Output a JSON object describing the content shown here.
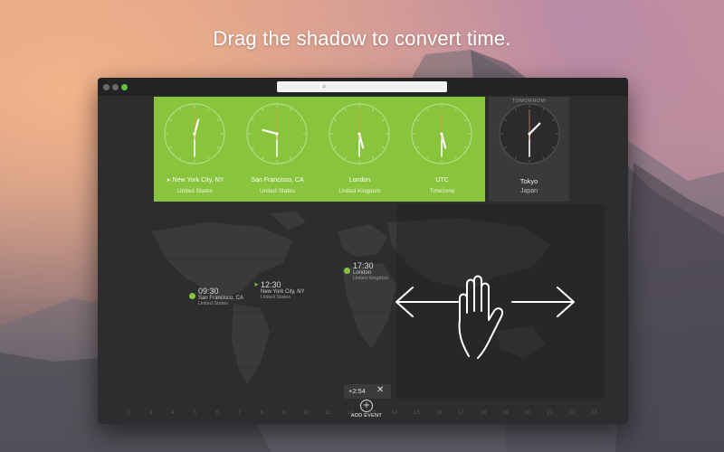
{
  "headline": "Drag the shadow to convert time.",
  "window": {
    "search_icon": "search-icon"
  },
  "clocks": [
    {
      "city": "New York City, NY",
      "country": "United States",
      "hour": 12,
      "minute": 30,
      "current_location": true
    },
    {
      "city": "San Francisco, CA",
      "country": "United States",
      "hour": 9,
      "minute": 30,
      "current_location": false
    },
    {
      "city": "London",
      "country": "United Kingdom",
      "hour": 17,
      "minute": 30,
      "current_location": false
    },
    {
      "city": "UTC",
      "country": "Timezone",
      "hour": 17,
      "minute": 30,
      "current_location": false
    }
  ],
  "tomorrow": {
    "label": "TOMORROW",
    "city": "Tokyo",
    "country": "Japan",
    "hour": 1,
    "minute": 30
  },
  "map_labels": {
    "sf": {
      "time": "09:30",
      "place": "San Francisco, CA",
      "country": "United States"
    },
    "nyc": {
      "time": "12:30",
      "place": "New York City, NY",
      "country": "United States"
    },
    "london": {
      "time": "17:30",
      "place": "London",
      "country": "United Kingdom"
    }
  },
  "offset": {
    "value": "+2:54",
    "close": "✕"
  },
  "add_event": {
    "label": "ADD EVENT",
    "icon": "+"
  },
  "timeline_hours": [
    "2",
    "3",
    "4",
    "5",
    "6",
    "7",
    "8",
    "9",
    "10",
    "11",
    "12",
    "13",
    "14",
    "15",
    "16",
    "17",
    "18",
    "19",
    "20",
    "21",
    "22",
    "23"
  ],
  "colors": {
    "accent": "#88c43c",
    "window": "#2d2d2f",
    "tomorrow": "#3a3a3d"
  }
}
